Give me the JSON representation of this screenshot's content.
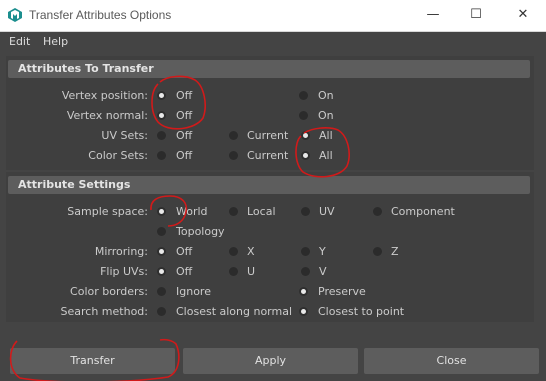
{
  "window": {
    "title": "Transfer Attributes Options",
    "minimize": "—",
    "maximize": "☐",
    "close": "✕"
  },
  "menu": [
    "Edit",
    "Help"
  ],
  "sections": {
    "attributes_to_transfer": "Attributes To Transfer",
    "attribute_settings": "Attribute Settings"
  },
  "rows": {
    "vertex_position": {
      "label": "Vertex position:",
      "options": [
        "Off",
        "On"
      ],
      "selected": "Off"
    },
    "vertex_normal": {
      "label": "Vertex normal:",
      "options": [
        "Off",
        "On"
      ],
      "selected": "Off"
    },
    "uv_sets": {
      "label": "UV Sets:",
      "options": [
        "Off",
        "Current",
        "All"
      ],
      "selected": "All"
    },
    "color_sets": {
      "label": "Color Sets:",
      "options": [
        "Off",
        "Current",
        "All"
      ],
      "selected": "All"
    },
    "sample_space": {
      "label": "Sample space:",
      "options": [
        "World",
        "Local",
        "UV",
        "Component",
        "Topology"
      ],
      "selected": "World"
    },
    "mirroring": {
      "label": "Mirroring:",
      "options": [
        "Off",
        "X",
        "Y",
        "Z"
      ],
      "selected": "Off"
    },
    "flip_uvs": {
      "label": "Flip UVs:",
      "options": [
        "Off",
        "U",
        "V"
      ],
      "selected": "Off"
    },
    "color_borders": {
      "label": "Color borders:",
      "options": [
        "Ignore",
        "Preserve"
      ],
      "selected": "Preserve"
    },
    "search_method": {
      "label": "Search method:",
      "options": [
        "Closest along normal",
        "Closest to point"
      ],
      "selected": "Closest to point"
    }
  },
  "buttons": {
    "transfer": "Transfer",
    "apply": "Apply",
    "close": "Close"
  },
  "colors": {
    "annotation": "#d11a1a",
    "background": "#444444",
    "section_header": "#5d5d5d"
  }
}
